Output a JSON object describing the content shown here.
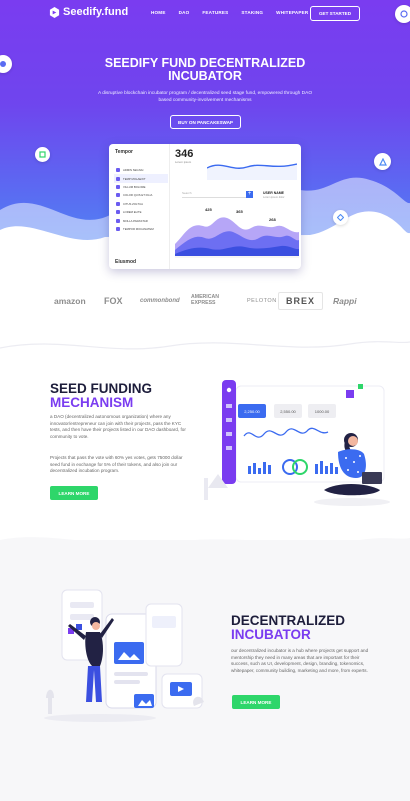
{
  "nav": {
    "brand": "Seedify.fund",
    "links": [
      "HOME",
      "DAO",
      "FEATURES",
      "STAKING",
      "WHITEPAPER"
    ],
    "cta": "GET STARTED"
  },
  "hero": {
    "title": "SEEDIFY FUND DECENTRALIZED INCUBATOR",
    "subtitle": "A disruptive blockchain incubator program / decentralized seed stage fund, empowered through DAO based community-involvement mechanisms",
    "button": "BUY ON PANCAKESWAP"
  },
  "dashboard": {
    "brand": "Tempor",
    "menu": [
      "ADMIN SEGNAI",
      "TEMP MOLAEXIT",
      "VILLUM BOLORE",
      "COLOR QUIS ET FILIA",
      "CITUS ZOLTUA",
      "LOREM ELITE",
      "MOLLA PARASTAR",
      "TEMPOR MOCANATEM"
    ],
    "footer": "Eiusmod",
    "stat": "346",
    "stat_label": "Lorem ipsum",
    "search": "Search",
    "user": "USER NAME",
    "user_sub": "Lorem ipsum dolor",
    "values": [
      "425",
      "365",
      "268"
    ]
  },
  "logos": [
    "amazon",
    "FOX",
    "commonbond",
    "AMERICAN EXPRESS",
    "PELOTON",
    "BREX",
    "Rappi"
  ],
  "section_funding": {
    "title_line1": "SEED FUNDING",
    "title_line2": "MECHANISM",
    "para1": "a DAO (decentralized autonomous organization) where any innovator/entrepreneur can join with their projects, pass the KYC tests, and then have their projects listed in our DAO dashboard, for community to vote.",
    "para2": "Projects that pass the vote with 60% yes votes, gets 75000 dollar seed fund in exchange for 5% of their tokens, and also join our decentralized incubation program.",
    "button": "LEARN MORE",
    "card_values": [
      "2,250.00",
      "2,550.00",
      "1000.00"
    ]
  },
  "section_incubator": {
    "title_line1": "DECENTRALIZED",
    "title_line2": "INCUBATOR",
    "para": "our decentralized incubator is a hub where projects get support and mentorship they need in many areas that are important for their success, such as UI, development, design, branding, tokenomics, whitepaper, community building, marketing and more, from experts.",
    "button": "LEARN MORE"
  },
  "colors": {
    "purple": "#7a3cf0",
    "blue": "#4f8cf4",
    "green": "#2ed66a",
    "navy": "#1d1d3b"
  }
}
